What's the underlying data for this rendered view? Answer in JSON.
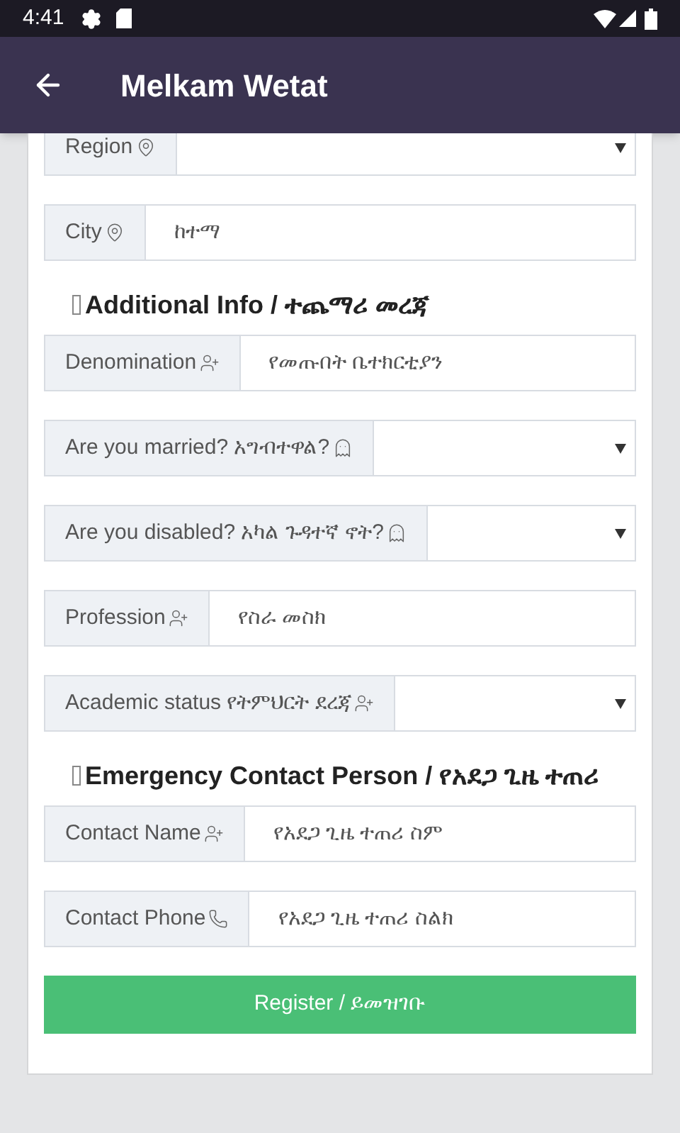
{
  "status_bar": {
    "time": "4:41"
  },
  "app_bar": {
    "title": "Melkam Wetat"
  },
  "sections": [
    {
      "kind": "fields",
      "fields": [
        {
          "kind": "select",
          "label": "Region"
        },
        {
          "kind": "text",
          "label": "City",
          "placeholder": "ከተማ"
        }
      ]
    },
    {
      "kind": "heading",
      "title": "Additional Info / ተጨማሪ መረጃ"
    },
    {
      "kind": "fields",
      "fields": [
        {
          "kind": "text",
          "label": "Denomination",
          "placeholder": "የመጡበት ቤተክርቲያን"
        },
        {
          "kind": "select",
          "label": "Are you married? አግብተዋል?"
        },
        {
          "kind": "select",
          "label": "Are you disabled? አካል ጉዳተኛ ኖት?"
        },
        {
          "kind": "text",
          "label": "Profession",
          "placeholder": "የስራ መስክ"
        },
        {
          "kind": "select",
          "label": "Academic status የትምህርት ደረጃ"
        }
      ]
    },
    {
      "kind": "heading",
      "title": "Emergency Contact Person / የአደጋ ጊዜ ተጠሪ"
    },
    {
      "kind": "fields",
      "fields": [
        {
          "kind": "text",
          "label": "Contact Name",
          "placeholder": "የአደጋ ጊዜ ተጠሪ ስም"
        },
        {
          "kind": "text",
          "label": "Contact Phone",
          "placeholder": "የአደጋ ጊዜ ተጠሪ ስልክ"
        }
      ]
    }
  ],
  "submit": {
    "label": "Register / ይመዝገቡ"
  }
}
